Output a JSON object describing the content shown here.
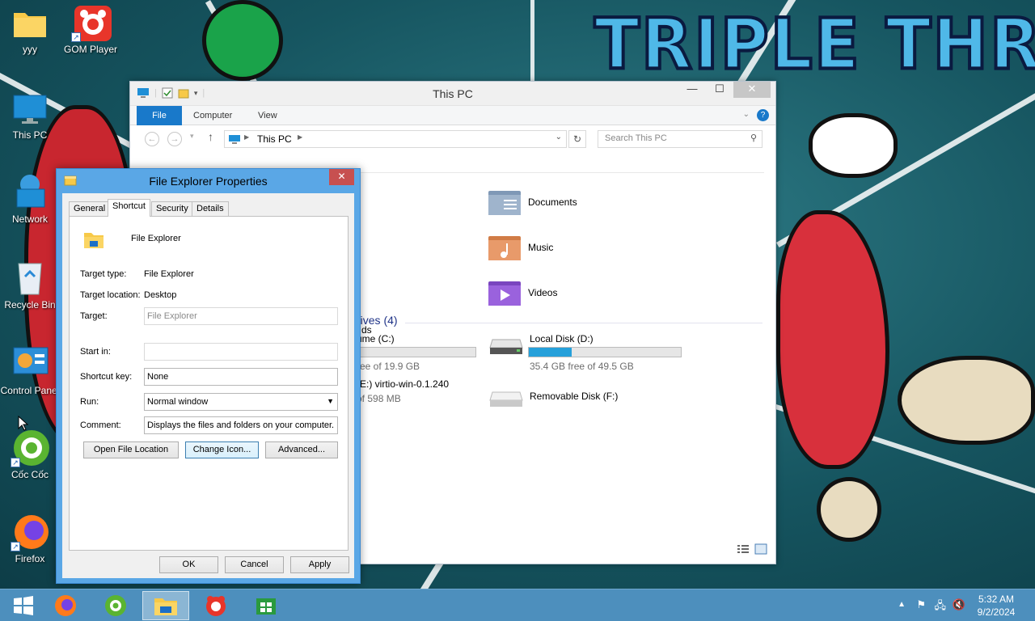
{
  "wallpaper": {
    "title": "TRIPLE THREAT"
  },
  "desktop_icons": [
    {
      "label": "yyy"
    },
    {
      "label": "GOM Player"
    },
    {
      "label": "This PC"
    },
    {
      "label": "Network"
    },
    {
      "label": "Recycle Bin"
    },
    {
      "label": "Control Panel"
    },
    {
      "label": "Cốc Cốc"
    },
    {
      "label": "Firefox"
    }
  ],
  "explorer": {
    "title": "This PC",
    "ribbon_tabs": [
      "File",
      "Computer",
      "View"
    ],
    "address": "This PC",
    "search_placeholder": "Search This PC",
    "folders": [
      {
        "name": "Documents"
      },
      {
        "name": "Music"
      },
      {
        "name": "Videos"
      },
      {
        "name": "ds"
      }
    ],
    "devices_header": "rives (4)",
    "drives": [
      {
        "name": "ume (C:)",
        "free": "ree of 19.9 GB",
        "used_fraction": 0.03
      },
      {
        "name": "Local Disk (D:)",
        "free": "35.4 GB free of 49.5 GB",
        "used_fraction": 0.28
      },
      {
        "name": "(E:) virtio-win-0.1.240",
        "free": "of 598 MB"
      },
      {
        "name": "Removable Disk (F:)"
      }
    ]
  },
  "dialog": {
    "title": "File Explorer Properties",
    "close_label": "✕",
    "tabs": [
      "General",
      "Shortcut",
      "Security",
      "Details"
    ],
    "app_name": "File Explorer",
    "target_type_label": "Target type:",
    "target_type_value": "File Explorer",
    "target_location_label": "Target location:",
    "target_location_value": "Desktop",
    "target_label": "Target:",
    "target_value": "File Explorer",
    "start_in_label": "Start in:",
    "start_in_value": "",
    "shortcut_key_label": "Shortcut key:",
    "shortcut_key_value": "None",
    "run_label": "Run:",
    "run_value": "Normal window",
    "comment_label": "Comment:",
    "comment_value": "Displays the files and folders on your computer.",
    "open_file_location": "Open File Location",
    "change_icon": "Change Icon...",
    "advanced": "Advanced...",
    "ok": "OK",
    "cancel": "Cancel",
    "apply": "Apply"
  },
  "taskbar": {
    "time": "5:32 AM",
    "date": "9/2/2024"
  }
}
